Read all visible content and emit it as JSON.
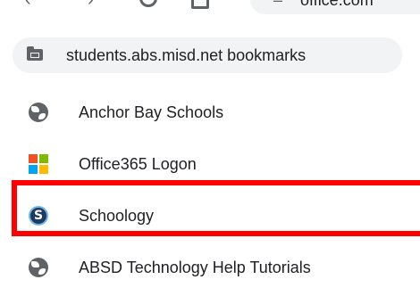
{
  "toolbar": {
    "back_glyph": "‹",
    "forward_glyph": "›",
    "omnibox_dash": "–",
    "omnibox_text": "office.com"
  },
  "folder": {
    "label": "students.abs.misd.net bookmarks",
    "icon": "folder-icon"
  },
  "bookmarks": [
    {
      "label": "Anchor Bay Schools",
      "icon": "globe-icon"
    },
    {
      "label": "Office365 Logon",
      "icon": "microsoft-icon"
    },
    {
      "label": "Schoology",
      "icon": "schoology-icon",
      "icon_letter": "S"
    },
    {
      "label": "ABSD Technology Help Tutorials",
      "icon": "globe-icon"
    }
  ],
  "colors": {
    "highlight": "#ff0000",
    "chip_background": "#f1f3f4",
    "icon_gray": "#5f6368",
    "text": "#202124"
  }
}
